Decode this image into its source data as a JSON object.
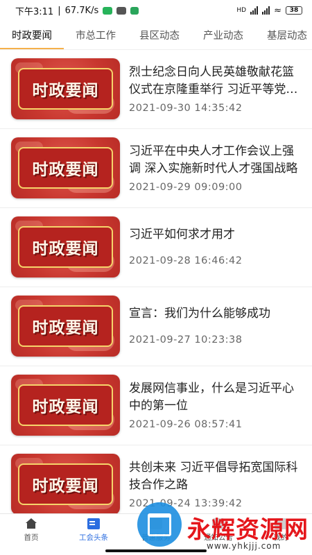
{
  "status_bar": {
    "time": "下午3:11",
    "network_speed": "67.7K/s",
    "battery": "38",
    "network_type": "HD"
  },
  "tabs": [
    {
      "label": "时政要闻",
      "active": true
    },
    {
      "label": "市总工作",
      "active": false
    },
    {
      "label": "县区动态",
      "active": false
    },
    {
      "label": "产业动态",
      "active": false
    },
    {
      "label": "基层动态",
      "active": false
    }
  ],
  "thumbnail_text": "时政要闻",
  "news": [
    {
      "title": "烈士纪念日向人民英雄敬献花篮仪式在京隆重举行 习近平等党和国家领导人出席",
      "date": "2021-09-30 14:35:42"
    },
    {
      "title": "习近平在中央人才工作会议上强调 深入实施新时代人才强国战略",
      "date": "2021-09-29 09:09:00"
    },
    {
      "title": "习近平如何求才用才",
      "date": "2021-09-28 16:46:42"
    },
    {
      "title": "宣言：我们为什么能够成功",
      "date": "2021-09-27 10:23:38"
    },
    {
      "title": "发展网信事业，什么是习近平心中的第一位",
      "date": "2021-09-26 08:57:41"
    },
    {
      "title": "共创未来 习近平倡导拓宽国际科技合作之路",
      "date": "2021-09-24 13:39:42"
    }
  ],
  "bottom_nav": [
    {
      "label": "首页",
      "icon": "home-icon",
      "active": false
    },
    {
      "label": "工会头条",
      "icon": "news-icon",
      "active": true
    },
    {
      "label": "普惠服务",
      "icon": "service-icon",
      "active": false
    },
    {
      "label": "通知公告",
      "icon": "notice-icon",
      "active": false
    },
    {
      "label": "我的",
      "icon": "profile-icon",
      "active": false
    }
  ],
  "watermark": {
    "text": "永辉资源网",
    "url": "www.yhkjjj.com"
  },
  "colors": {
    "tab_indicator": "#f5b04a",
    "nav_active": "#2b6de0",
    "thumb_red": "#c8372f",
    "thumb_border": "#f6d56b",
    "watermark_red": "#e5161b"
  }
}
